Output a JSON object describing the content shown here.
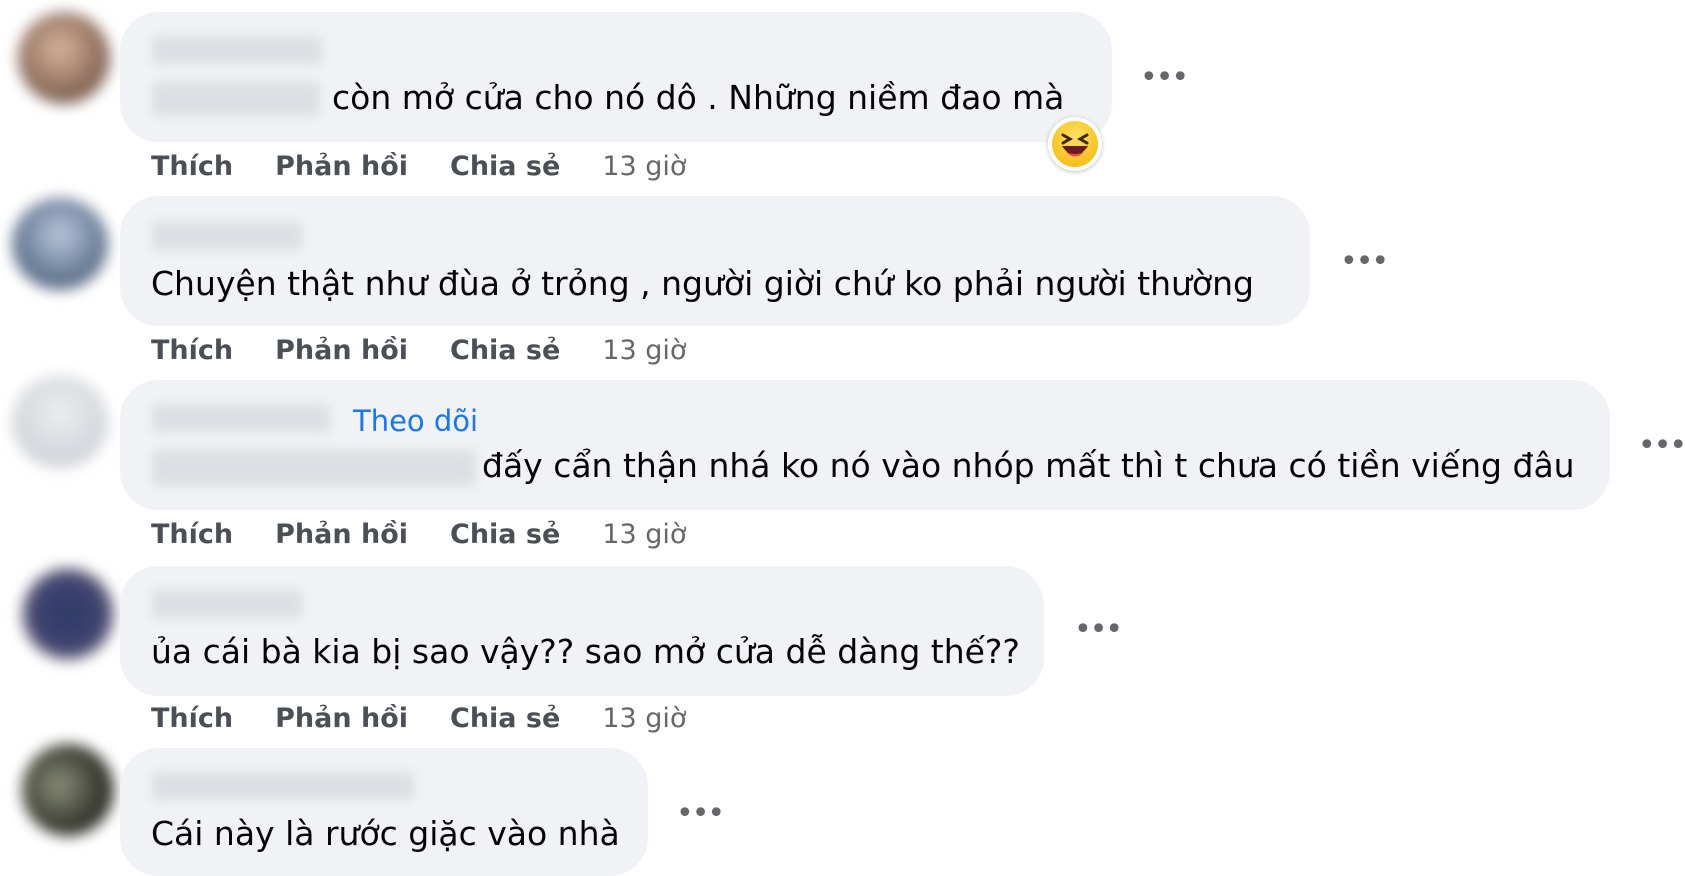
{
  "actions": {
    "like": "Thích",
    "reply": "Phản hồi",
    "share": "Chia sẻ"
  },
  "more_label": "•••",
  "comments": [
    {
      "text": "còn mở cửa cho nó dô . Những niềm đao mà",
      "time": "13 giờ",
      "reaction_icon": "laughing-emoji-icon"
    },
    {
      "text": "Chuyện thật như đùa ở trỏng , người giời chứ ko phải người thường",
      "time": "13 giờ"
    },
    {
      "text": "đấy cẩn thận nhá ko nó vào nhóp mất thì t chưa có tiền viếng đâu",
      "time": "13 giờ",
      "follow": "Theo dõi"
    },
    {
      "text": "ủa cái bà kia bị sao vậy?? sao mở cửa dễ dàng thế??",
      "time": "13 giờ"
    },
    {
      "text": "Cái này là rước giặc vào nhà"
    }
  ],
  "colors": {
    "bubble": "#f0f2f5",
    "link": "#1877f2",
    "muted": "#65676b"
  }
}
